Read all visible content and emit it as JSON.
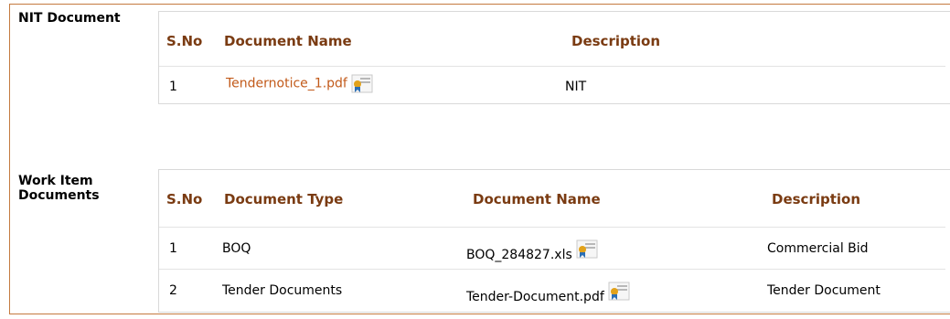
{
  "nit": {
    "label": "NIT Document",
    "headers": {
      "sno": "S.No",
      "name": "Document Name",
      "description": "Description"
    },
    "rows": [
      {
        "sno": "1",
        "name": "Tendernotice_1.pdf",
        "description": "NIT",
        "icon": "certificate-icon"
      }
    ]
  },
  "work": {
    "label_line1": "Work Item",
    "label_line2": "Documents",
    "headers": {
      "sno": "S.No",
      "type": "Document Type",
      "name": "Document Name",
      "description": "Description"
    },
    "rows": [
      {
        "sno": "1",
        "type": "BOQ",
        "name": "BOQ_284827.xls",
        "description": "Commercial Bid",
        "icon": "certificate-icon"
      },
      {
        "sno": "2",
        "type": "Tender Documents",
        "name": "Tender-Document.pdf",
        "description": "Tender Document",
        "icon": "certificate-icon"
      }
    ]
  },
  "colors": {
    "header_text": "#7a3b12",
    "link_text": "#c25a1a",
    "frame_border": "#c47a3f"
  }
}
